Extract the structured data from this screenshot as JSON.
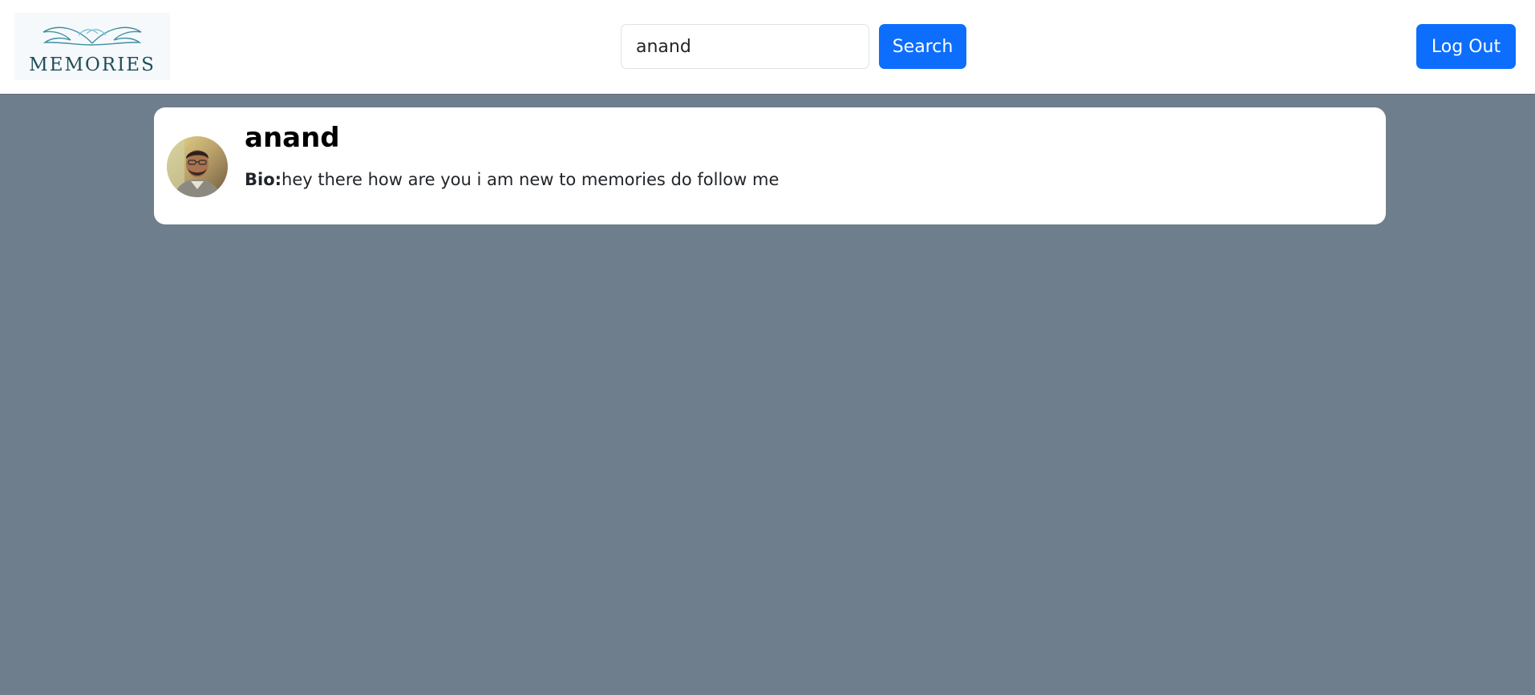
{
  "header": {
    "logo_text": "MEMORIES",
    "search": {
      "value": "anand",
      "button_label": "Search"
    },
    "logout_label": "Log Out"
  },
  "results": [
    {
      "username": "anand",
      "bio_label": "Bio:",
      "bio_text": "hey there how are you i am new to memories do follow me"
    }
  ],
  "colors": {
    "background": "#6f7e8c",
    "primary": "#0d6efd",
    "card": "#ffffff"
  }
}
